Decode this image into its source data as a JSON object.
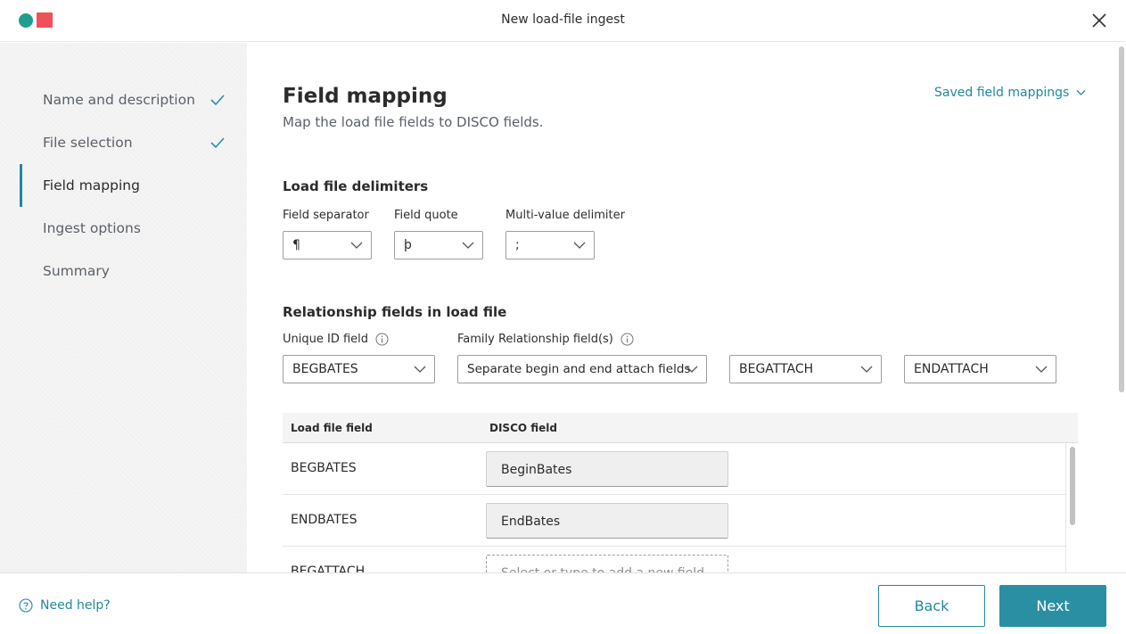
{
  "header": {
    "title": "New load-file ingest"
  },
  "sidebar": {
    "items": [
      {
        "label": "Name and description",
        "done": true
      },
      {
        "label": "File selection",
        "done": true
      },
      {
        "label": "Field mapping",
        "active": true
      },
      {
        "label": "Ingest options"
      },
      {
        "label": "Summary"
      }
    ]
  },
  "main": {
    "title": "Field mapping",
    "subtitle": "Map the load file fields to DISCO fields.",
    "saved_link": "Saved field mappings",
    "delimiters": {
      "title": "Load file delimiters",
      "field_separator": {
        "label": "Field separator",
        "value": "¶"
      },
      "field_quote": {
        "label": "Field quote",
        "value": "þ"
      },
      "multi_value": {
        "label": "Multi-value delimiter",
        "value": ";"
      }
    },
    "relationship": {
      "title": "Relationship fields in load file",
      "unique_id": {
        "label": "Unique ID field",
        "value": "BEGBATES"
      },
      "family": {
        "label": "Family Relationship field(s)",
        "value": "Separate begin and end attach fields"
      },
      "begin_attach": {
        "value": "BEGATTACH"
      },
      "end_attach": {
        "value": "ENDATTACH"
      }
    },
    "table": {
      "headers": [
        "Load file field",
        "DISCO field"
      ],
      "rows": [
        {
          "load_field": "BEGBATES",
          "disco_field": "BeginBates"
        },
        {
          "load_field": "ENDBATES",
          "disco_field": "EndBates"
        },
        {
          "load_field": "BEGATTACH",
          "disco_placeholder": "Select or type to add a new field"
        }
      ]
    }
  },
  "footer": {
    "help": "Need help?",
    "back": "Back",
    "next": "Next"
  },
  "colors": {
    "accent": "#1f8a9e",
    "logo_teal": "#1f9e8f",
    "logo_red": "#f0505a"
  }
}
